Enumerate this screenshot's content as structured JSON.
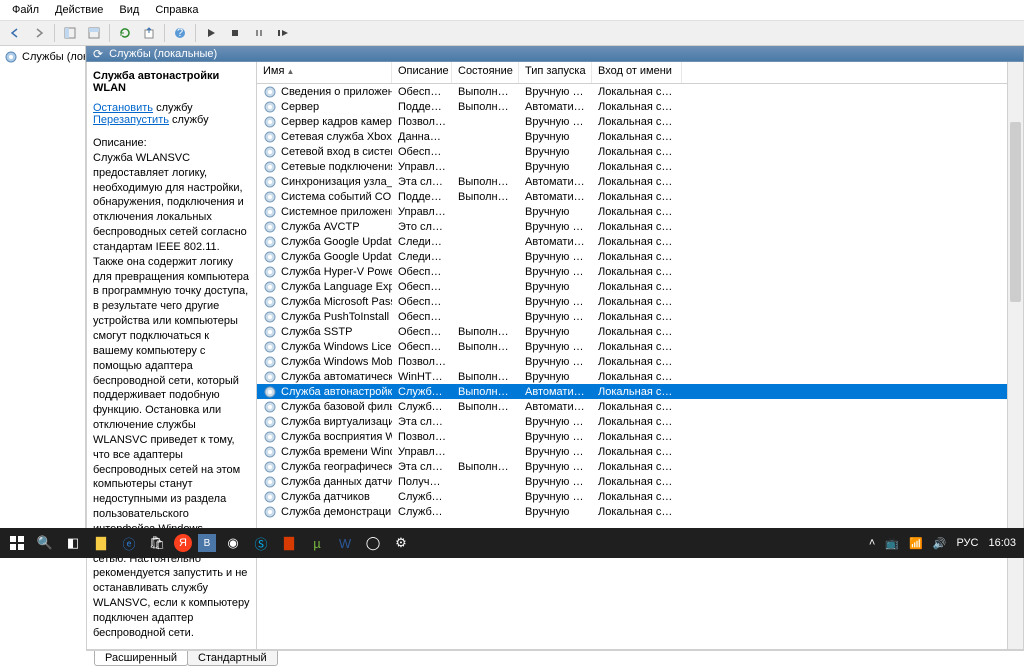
{
  "menu": {
    "file": "Файл",
    "action": "Действие",
    "view": "Вид",
    "help": "Справка"
  },
  "tree": {
    "root": "Службы (локальны"
  },
  "tab_title": "Службы (локальные)",
  "detail": {
    "title": "Служба автонастройки WLAN",
    "stop_link": "Остановить",
    "stop_suffix": " службу",
    "restart_link": "Перезапустить",
    "restart_suffix": " службу",
    "desc_label": "Описание:",
    "desc_body": "Служба WLANSVC предоставляет логику, необходимую для настройки, обнаружения, подключения и отключения локальных беспроводных сетей согласно стандартам IEEE 802.11. Также она содержит логику для превращения компьютера в программную точку доступа, в результате чего другие устройства или компьютеры смогут подключаться к вашему компьютеру с помощью адаптера беспроводной сети, который поддерживает подобную функцию. Остановка или отключение службы WLANSVC приведет к тому, что все адаптеры беспроводных сетей на этом компьютеры станут недоступными из раздела пользовательского интерфейса Windows, отвечающего за управление сетью. Настоятельно рекомендуется запустить и не останавливать службу WLANSVC, если к компьютеру подключен адаптер беспроводной сети."
  },
  "columns": {
    "name": "Имя",
    "desc": "Описание",
    "state": "Состояние",
    "start": "Тип запуска",
    "logon": "Вход от имени"
  },
  "rows": [
    {
      "name": "Сведения о приложении",
      "desc": "Обеспечи...",
      "state": "Выполняется",
      "start": "Вручную (ак...",
      "logon": "Локальная сис..."
    },
    {
      "name": "Сервер",
      "desc": "Поддерж...",
      "state": "Выполняется",
      "start": "Автоматиче...",
      "logon": "Локальная сис..."
    },
    {
      "name": "Сервер кадров камеры Wi...",
      "desc": "Позволяет...",
      "state": "",
      "start": "Вручную (ак...",
      "logon": "Локальная слу..."
    },
    {
      "name": "Сетевая служба Xbox Live",
      "desc": "Данная слу...",
      "state": "",
      "start": "Вручную",
      "logon": "Локальная сис..."
    },
    {
      "name": "Сетевой вход в систему",
      "desc": "Обеспечи...",
      "state": "",
      "start": "Вручную",
      "logon": "Локальная сис..."
    },
    {
      "name": "Сетевые подключения",
      "desc": "Управляет...",
      "state": "",
      "start": "Вручную",
      "logon": "Локальная сис..."
    },
    {
      "name": "Синхронизация узла_3318...",
      "desc": "Эта служб...",
      "state": "Выполняется",
      "start": "Автоматиче...",
      "logon": "Локальная сис..."
    },
    {
      "name": "Система событий COM+",
      "desc": "Поддерж...",
      "state": "Выполняется",
      "start": "Автоматиче...",
      "logon": "Локальная слу..."
    },
    {
      "name": "Системное приложение C...",
      "desc": "Управлен...",
      "state": "",
      "start": "Вручную",
      "logon": "Локальная сис..."
    },
    {
      "name": "Служба AVCTP",
      "desc": "Это служб...",
      "state": "",
      "start": "Вручную (ак...",
      "logon": "Локальная слу..."
    },
    {
      "name": "Служба Google Update (gu...",
      "desc": "Следите за...",
      "state": "",
      "start": "Автоматиче...",
      "logon": "Локальная сис..."
    },
    {
      "name": "Служба Google Update (gu...",
      "desc": "Следите за...",
      "state": "",
      "start": "Вручную (ак...",
      "logon": "Локальная сис..."
    },
    {
      "name": "Служба Hyper-V PowerShe...",
      "desc": "Обеспечи...",
      "state": "",
      "start": "Вручную (ак...",
      "logon": "Локальная сис..."
    },
    {
      "name": "Служба Language Experien...",
      "desc": "Обеспечи...",
      "state": "",
      "start": "Вручную",
      "logon": "Локальная сис..."
    },
    {
      "name": "Служба Microsoft Passport",
      "desc": "Обеспечи...",
      "state": "",
      "start": "Вручную (ак...",
      "logon": "Локальная сис..."
    },
    {
      "name": "Служба PushToInstall Wind...",
      "desc": "Обеспечи...",
      "state": "",
      "start": "Вручную (ак...",
      "logon": "Локальная сис..."
    },
    {
      "name": "Служба SSTP",
      "desc": "Обеспечи...",
      "state": "Выполняется",
      "start": "Вручную",
      "logon": "Локальная слу..."
    },
    {
      "name": "Служба Windows License ...",
      "desc": "Обеспечи...",
      "state": "Выполняется",
      "start": "Вручную (ак...",
      "logon": "Локальная сис..."
    },
    {
      "name": "Служба Windows Mobile H...",
      "desc": "Позволяет...",
      "state": "",
      "start": "Вручную (ак...",
      "logon": "Локальная слу..."
    },
    {
      "name": "Служба автоматического ...",
      "desc": "WinHTTP ...",
      "state": "Выполняется",
      "start": "Вручную",
      "logon": "Локальная сис..."
    },
    {
      "name": "Служба автонастройки W...",
      "desc": "Служба W...",
      "state": "Выполняется",
      "start": "Автоматиче...",
      "logon": "Локальная сис...",
      "selected": true
    },
    {
      "name": "Служба базовой фильтра...",
      "desc": "Служба ба...",
      "state": "Выполняется",
      "start": "Автоматиче...",
      "logon": "Локальная слу..."
    },
    {
      "name": "Служба виртуализации уд...",
      "desc": "Эта служб...",
      "state": "",
      "start": "Вручную (ак...",
      "logon": "Локальная сис..."
    },
    {
      "name": "Служба восприятия Wind...",
      "desc": "Позволяет...",
      "state": "",
      "start": "Вручную (ак...",
      "logon": "Локальная сис..."
    },
    {
      "name": "Служба времени Windows",
      "desc": "Управляет...",
      "state": "",
      "start": "Вручную (ак...",
      "logon": "Локальная слу..."
    },
    {
      "name": "Служба географического ...",
      "desc": "Эта служб...",
      "state": "Выполняется",
      "start": "Вручную (ак...",
      "logon": "Локальная сис..."
    },
    {
      "name": "Служба данных датчиков",
      "desc": "Получени...",
      "state": "",
      "start": "Вручную (ак...",
      "logon": "Локальная сис..."
    },
    {
      "name": "Служба датчиков",
      "desc": "Служба се...",
      "state": "",
      "start": "Вручную (ак...",
      "logon": "Локальная сис..."
    },
    {
      "name": "Служба демонстрации ма...",
      "desc": "Служба де...",
      "state": "",
      "start": "Вручную",
      "logon": "Локальная сис..."
    }
  ],
  "bottom_tabs": {
    "extended": "Расширенный",
    "standard": "Стандартный"
  },
  "taskbar": {
    "lang": "РУС",
    "time": "16:03"
  }
}
